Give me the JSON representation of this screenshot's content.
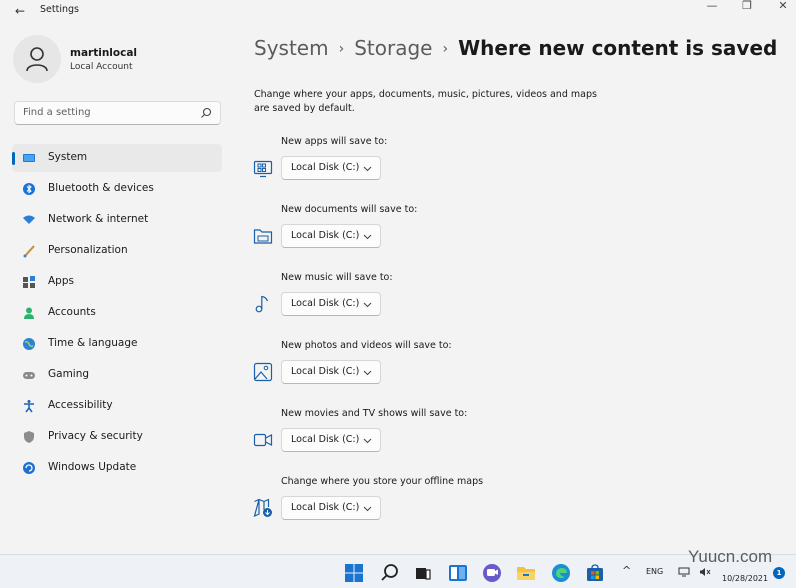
{
  "window": {
    "title": "Settings",
    "back_glyph": "←",
    "min_glyph": "—",
    "max_glyph": "❐",
    "close_glyph": "✕"
  },
  "profile": {
    "name": "martinlocal",
    "account_type": "Local Account"
  },
  "search": {
    "placeholder": "Find a setting"
  },
  "nav": {
    "items": [
      {
        "label": "System",
        "icon": "system-icon",
        "selected": true
      },
      {
        "label": "Bluetooth & devices",
        "icon": "bluetooth-icon"
      },
      {
        "label": "Network & internet",
        "icon": "network-icon"
      },
      {
        "label": "Personalization",
        "icon": "brush-icon"
      },
      {
        "label": "Apps",
        "icon": "apps-icon"
      },
      {
        "label": "Accounts",
        "icon": "accounts-icon"
      },
      {
        "label": "Time & language",
        "icon": "globe-icon"
      },
      {
        "label": "Gaming",
        "icon": "gamepad-icon"
      },
      {
        "label": "Accessibility",
        "icon": "accessibility-icon"
      },
      {
        "label": "Privacy & security",
        "icon": "shield-icon"
      },
      {
        "label": "Windows Update",
        "icon": "update-icon"
      }
    ]
  },
  "header": {
    "breadcrumb": [
      "System",
      "Storage"
    ],
    "separator": "›",
    "current": "Where new content is saved"
  },
  "description": "Change where your apps, documents, music, pictures, videos and maps are saved by default.",
  "rows": [
    {
      "label": "New apps will save to:",
      "value": "Local Disk (C:)",
      "icon": "apps-save-icon"
    },
    {
      "label": "New documents will save to:",
      "value": "Local Disk (C:)",
      "icon": "folder-icon"
    },
    {
      "label": "New music will save to:",
      "value": "Local Disk (C:)",
      "icon": "music-note-icon"
    },
    {
      "label": "New photos and videos will save to:",
      "value": "Local Disk (C:)",
      "icon": "photo-icon"
    },
    {
      "label": "New movies and TV shows will save to:",
      "value": "Local Disk (C:)",
      "icon": "video-camera-icon"
    },
    {
      "label": "Change where you store your offline maps",
      "value": "Local Disk (C:)",
      "icon": "map-download-icon"
    }
  ],
  "taskbar": {
    "tray_chevron": "^",
    "language": "ENG",
    "date": "10/28/2021",
    "notification_count": "1"
  },
  "watermark": "Yuucn.com",
  "colors": {
    "accent": "#0067c0",
    "background": "#f3f3f3",
    "selected_nav": "#e9e9e9"
  }
}
